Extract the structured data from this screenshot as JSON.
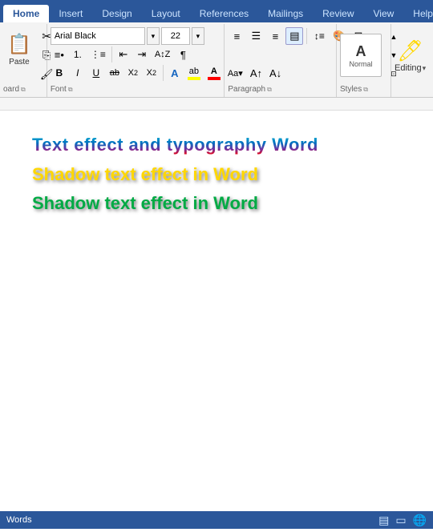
{
  "tabs": [
    {
      "label": "Home",
      "active": true
    },
    {
      "label": "Insert",
      "active": false
    },
    {
      "label": "Design",
      "active": false
    },
    {
      "label": "Layout",
      "active": false
    },
    {
      "label": "References",
      "active": false
    },
    {
      "label": "Mailings",
      "active": false
    },
    {
      "label": "Review",
      "active": false
    },
    {
      "label": "View",
      "active": false
    },
    {
      "label": "Help",
      "active": false
    }
  ],
  "font": {
    "name": "Arial Black",
    "size": "22"
  },
  "clipboard_label": "oard",
  "font_label": "Font",
  "paragraph_label": "Paragraph",
  "styles_label": "Styles",
  "editing_label": "Editing",
  "styles_btn_label": "Normal",
  "doc": {
    "line1": "Text effect and typography Word",
    "line2": "Shadow text effect in Word",
    "line3": "Shadow text effect in Word"
  },
  "status": {
    "words": "Words",
    "word_count": ""
  }
}
